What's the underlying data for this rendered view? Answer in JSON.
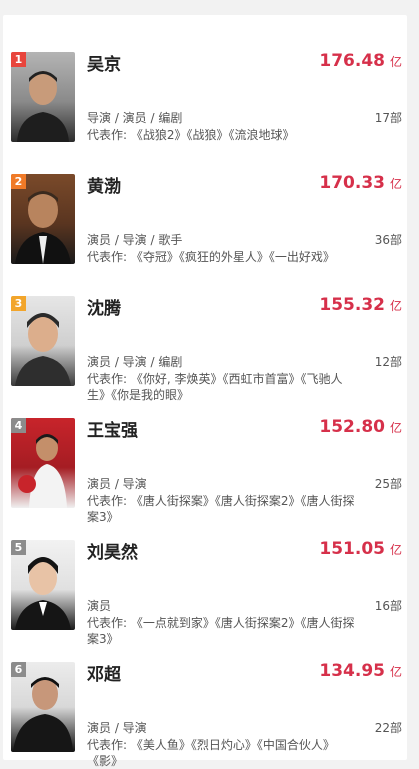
{
  "actors": [
    {
      "rank": "1",
      "name": "吴京",
      "box_value": "176.48",
      "box_unit": "亿",
      "roles": "导演 / 演员 / 编剧",
      "works_count": "17部",
      "works": "代表作: 《战狼2》《战狼》《流浪地球》",
      "rank_color": "#e8453c"
    },
    {
      "rank": "2",
      "name": "黄渤",
      "box_value": "170.33",
      "box_unit": "亿",
      "roles": "演员 / 导演 / 歌手",
      "works_count": "36部",
      "works": "代表作: 《夺冠》《疯狂的外星人》《一出好戏》",
      "rank_color": "#f07a27"
    },
    {
      "rank": "3",
      "name": "沈腾",
      "box_value": "155.32",
      "box_unit": "亿",
      "roles": "演员 / 导演 / 编剧",
      "works_count": "12部",
      "works": "代表作: 《你好, 李焕英》《西虹市首富》《飞驰人生》《你是我的眼》",
      "rank_color": "#f2a52b"
    },
    {
      "rank": "4",
      "name": "王宝强",
      "box_value": "152.80",
      "box_unit": "亿",
      "roles": "演员 / 导演",
      "works_count": "25部",
      "works": "代表作: 《唐人街探案》《唐人街探案2》《唐人街探案3》",
      "rank_color": "#8c8c8c"
    },
    {
      "rank": "5",
      "name": "刘昊然",
      "box_value": "151.05",
      "box_unit": "亿",
      "roles": "演员",
      "works_count": "16部",
      "works": "代表作: 《一点就到家》《唐人街探案2》《唐人街探案3》",
      "rank_color": "#8c8c8c"
    },
    {
      "rank": "6",
      "name": "邓超",
      "box_value": "134.95",
      "box_unit": "亿",
      "roles": "演员 / 导演",
      "works_count": "22部",
      "works": "代表作: 《美人鱼》《烈日灼心》《中国合伙人》《影》",
      "rank_color": "#8c8c8c"
    }
  ]
}
